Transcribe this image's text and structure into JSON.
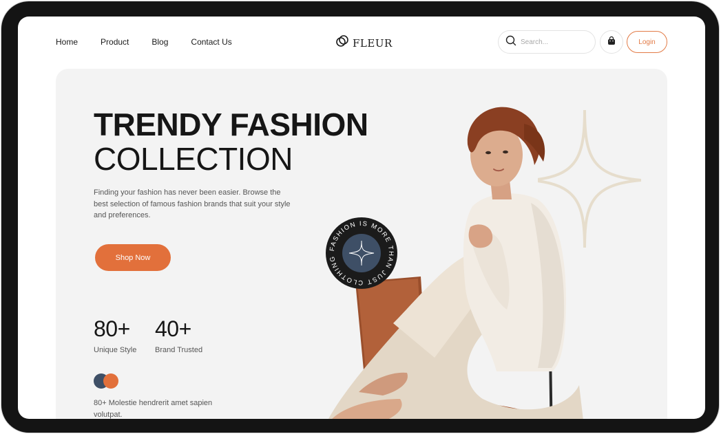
{
  "nav": {
    "links": [
      "Home",
      "Product",
      "Blog",
      "Contact Us"
    ]
  },
  "brand": {
    "name": "FLEUR",
    "logo_icon": "interlocked-rings-icon"
  },
  "search": {
    "placeholder": "Search...",
    "value": "",
    "icon": "search-icon"
  },
  "cart": {
    "icon": "shopping-bag-icon"
  },
  "login": {
    "label": "Login"
  },
  "hero": {
    "title_line1": "TRENDY FASHION",
    "title_line2": "COLLECTION",
    "description": "Finding your fashion has never been easier. Browse the best selection of famous fashion brands that suit your style and preferences.",
    "cta_label": "Shop Now",
    "stats": [
      {
        "value": "80+",
        "label": "Unique Style"
      },
      {
        "value": "40+",
        "label": "Brand Trusted"
      }
    ],
    "footnote": "80+ Molestie hendrerit amet sapien volutpat.",
    "badge_text": "FASHION IS MORE THAN JUST CLOTHING",
    "badge_icon": "sparkle-icon"
  },
  "colors": {
    "accent": "#e2703b",
    "navy": "#3e4f66",
    "hero_bg": "#f3f3f3",
    "dark": "#161616"
  }
}
